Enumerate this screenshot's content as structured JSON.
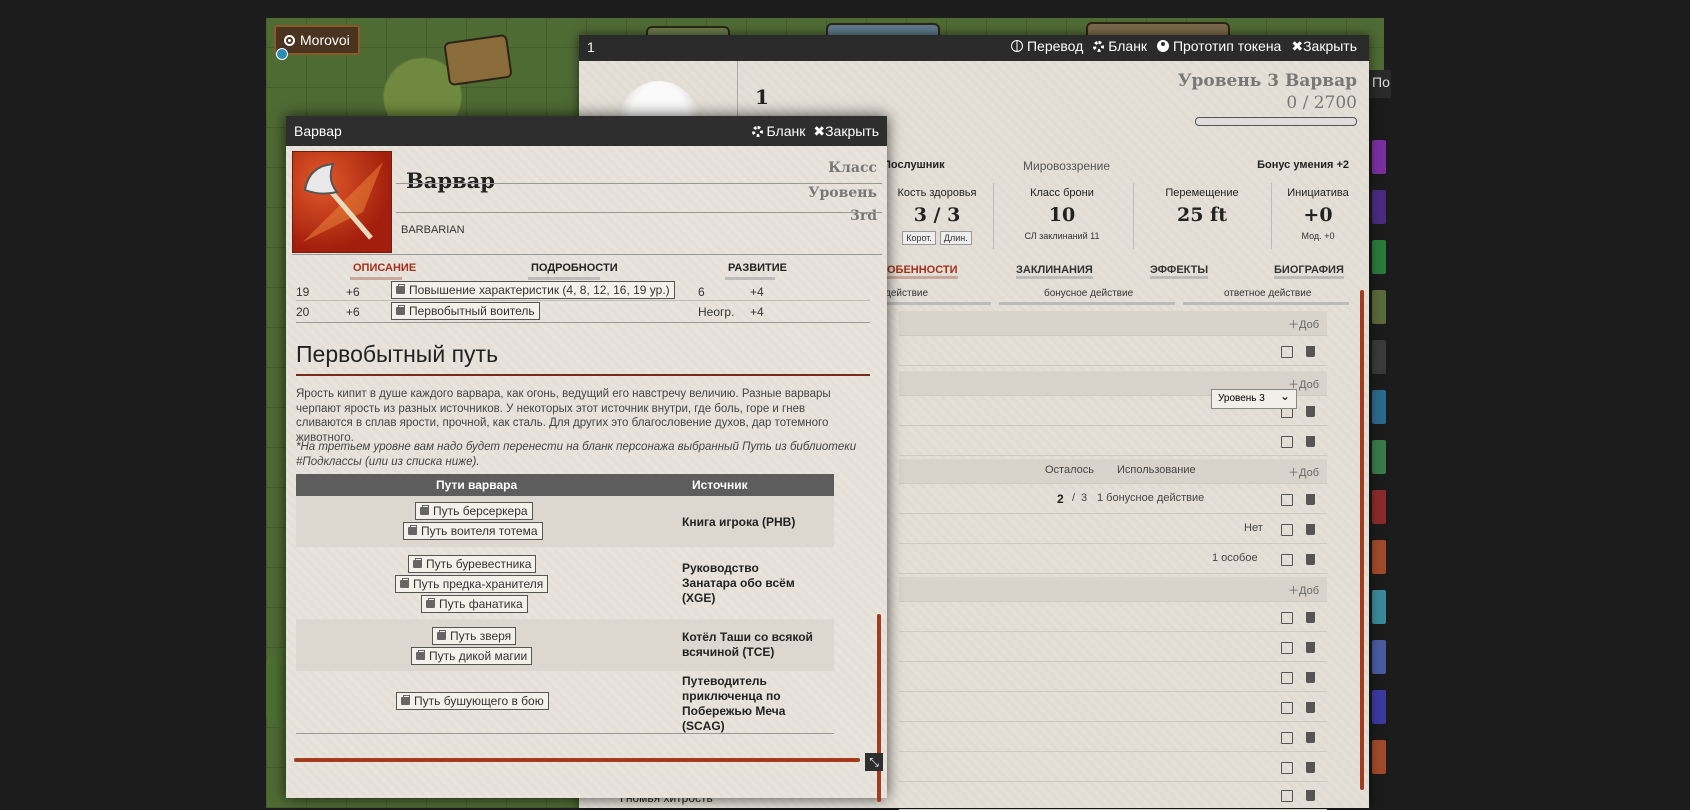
{
  "player": {
    "name": "Morovoi"
  },
  "sheet": {
    "number": "1",
    "actions": {
      "translate": "Перевод",
      "blank": "Бланк",
      "token": "Прототип токена",
      "close": "Закрыть"
    },
    "char_name": "1",
    "level_class": "Уровень 3 Варвар",
    "xp_current": "0",
    "xp_sep": "/",
    "xp_next": "2700",
    "info": {
      "background": "Послушник",
      "alignment": "Мировоззрение",
      "proficiency": "Бонус умения +2"
    },
    "stats": [
      {
        "label": "Кость здоровья",
        "value": "3 / 3",
        "btn1": "Корот.",
        "btn2": "Длин."
      },
      {
        "label": "Класс брони",
        "value": "10",
        "sub": "СЛ заклинаний 11"
      },
      {
        "label": "Перемещение",
        "value": "25 ft"
      },
      {
        "label": "Инициатива",
        "value": "+0",
        "sub_a": "Мод.",
        "sub_b": "+0"
      }
    ],
    "tabs": [
      "ОБЕННОСТИ",
      "ЗАКЛИНАНИЯ",
      "ЭФФЕКТЫ",
      "БИОГРАФИЯ"
    ],
    "subtabs": [
      "действие",
      "бонусное действие",
      "ответное действие"
    ],
    "add_label": "Доб",
    "level_select": "Уровень 3",
    "col_left": "Осталось",
    "col_use": "Использование",
    "uses_current": "2",
    "uses_sep": "/",
    "uses_max": "3",
    "uses_type": "1 бонусное действие",
    "row_no": "Нет",
    "row_special": "1 особое",
    "bottom_item": "Гномья хитрость"
  },
  "popup": {
    "title": "Варвар",
    "actions": {
      "blank": "Бланк",
      "close": "Закрыть"
    },
    "class_name": "Варвар",
    "class_en": "BARBARIAN",
    "label_class": "Класс",
    "label_level": "Уровень",
    "level_value": "3rd",
    "tabs": {
      "description": "ОПИСАНИЕ",
      "details": "ПОДРОБНОСТИ",
      "progression": "РАЗВИТИЕ"
    },
    "rows": [
      {
        "level": "19",
        "bonus": "+6",
        "feature": "Повышение характеристик (4, 8, 12, 16, 19 ур.)",
        "rages": "6",
        "damage": "+4"
      },
      {
        "level": "20",
        "bonus": "+6",
        "feature": "Первобытный воитель",
        "rages": "Неогр.",
        "damage": "+4"
      }
    ],
    "section_title": "Первобытный путь",
    "paragraph": "Ярость кипит в душе каждого варвара, как огонь, ведущий его навстречу величию. Разные варвары черпают ярость из разных источников. У некоторых этот источник внутри, где боль, горе и гнев сливаются в сплав ярости, прочной, как сталь. Для других это благословение духов, дар тотемного животного.",
    "note": "*На третьем уровне вам надо будет перенести на бланк персонажа выбранный Путь из библиотеки #Подклассы (или из списка ниже).",
    "table": {
      "header_paths": "Пути варвара",
      "header_source": "Источник",
      "groups": [
        {
          "paths": [
            "Путь берсеркера",
            "Путь воителя тотема"
          ],
          "source": "Книга игрока (PHB)"
        },
        {
          "paths": [
            "Путь буревестника",
            "Путь предка-хранителя",
            "Путь фанатика"
          ],
          "source": "Руководство Занатара обо всём (XGE)"
        },
        {
          "paths": [
            "Путь зверя",
            "Путь дикой магии"
          ],
          "source": "Котёл Таши со всякой всячиной (TCE)"
        },
        {
          "paths": [
            "Путь бушующего в бою"
          ],
          "source": "Путеводитель приключенца по Побережью Меча (SCAG)"
        }
      ]
    }
  },
  "strip_head": "По",
  "colors": {
    "accent": "#a3301a",
    "titlebar": "#2e2e2e",
    "parchment": "#e7e3db"
  }
}
